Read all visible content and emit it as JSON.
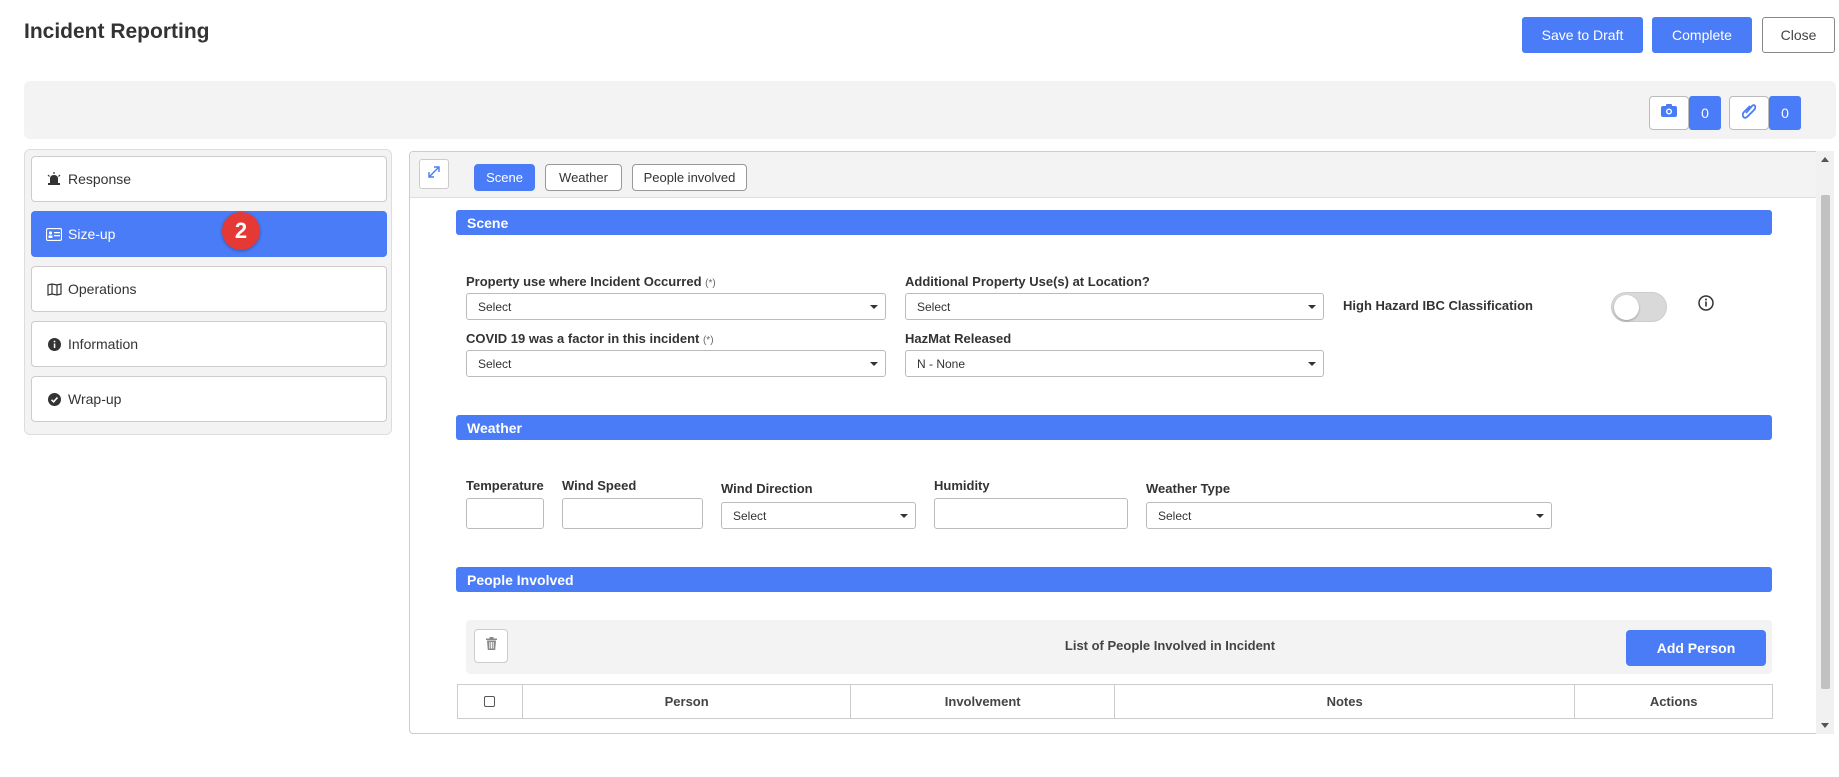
{
  "header": {
    "title": "Incident Reporting",
    "save_draft_label": "Save to Draft",
    "complete_label": "Complete",
    "close_label": "Close"
  },
  "toolbar": {
    "photo_count": "0",
    "attachment_count": "0"
  },
  "sidebar": {
    "items": [
      {
        "label": "Response",
        "icon": "siren-icon"
      },
      {
        "label": "Size-up",
        "icon": "id-card-icon",
        "active": true
      },
      {
        "label": "Operations",
        "icon": "map-icon"
      },
      {
        "label": "Information",
        "icon": "info-circle-icon"
      },
      {
        "label": "Wrap-up",
        "icon": "check-circle-icon"
      }
    ],
    "step_badge": "2"
  },
  "tabs": [
    {
      "label": "Scene",
      "active": true
    },
    {
      "label": "Weather"
    },
    {
      "label": "People involved"
    }
  ],
  "scene": {
    "section_title": "Scene",
    "property_use_label": "Property use where Incident Occurred",
    "property_use_req": "(*)",
    "property_use_value": "Select",
    "additional_property_label": "Additional Property Use(s) at Location?",
    "additional_property_value": "Select",
    "high_hazard_label": "High Hazard IBC Classification",
    "covid_label": "COVID 19 was a factor in this incident",
    "covid_req": "(*)",
    "covid_value": "Select",
    "hazmat_label": "HazMat Released",
    "hazmat_value": "N - None"
  },
  "weather": {
    "section_title": "Weather",
    "temperature_label": "Temperature",
    "wind_speed_label": "Wind Speed",
    "wind_direction_label": "Wind Direction",
    "wind_direction_value": "Select",
    "humidity_label": "Humidity",
    "weather_type_label": "Weather Type",
    "weather_type_value": "Select"
  },
  "people": {
    "section_title": "People Involved",
    "list_title": "List of People Involved in Incident",
    "add_person_label": "Add Person",
    "columns": [
      "Person",
      "Involvement",
      "Notes",
      "Actions"
    ]
  },
  "colors": {
    "accent": "#4a7cf7",
    "badge": "#e53935"
  }
}
